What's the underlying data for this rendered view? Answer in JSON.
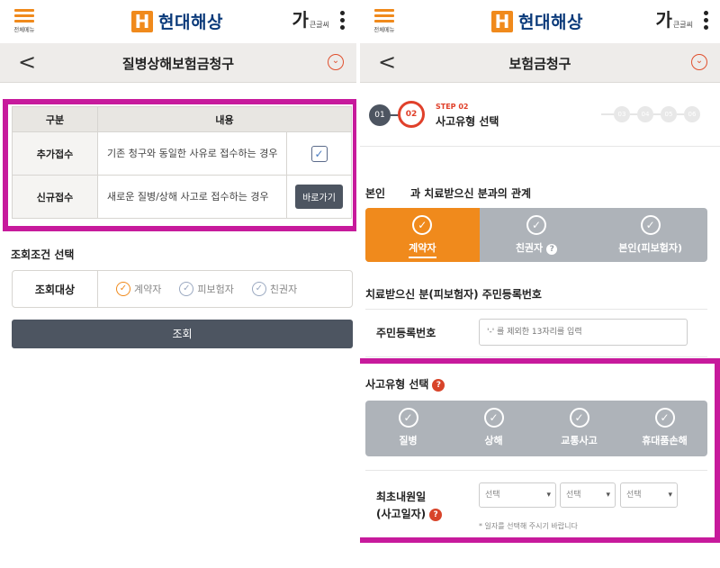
{
  "common": {
    "menu_label": "전체메뉴",
    "logo_mark": "H",
    "logo_text": "현대해상",
    "fontsize_big": "가",
    "fontsize_small": "큰글씨",
    "back_glyph": "<",
    "help_glyph": "⌄",
    "accent_color": "#f08a1c",
    "highlight_color": "#c71a9c"
  },
  "left": {
    "title": "질병상해보험금청구",
    "table": {
      "headers": [
        "구분",
        "내용"
      ],
      "rows": [
        {
          "kind": "추가접수",
          "desc": "기존 청구와 동일한 사유로 접수하는 경우",
          "action": "checkbox"
        },
        {
          "kind": "신규접수",
          "desc": "새로운 질병/상해 사고로 접수하는 경우",
          "action_label": "바로가기"
        }
      ]
    },
    "query_section_title": "조회조건 선택",
    "query_label": "조회대상",
    "options": [
      {
        "label": "계약자",
        "selected": true
      },
      {
        "label": "피보험자",
        "selected": false
      },
      {
        "label": "친권자",
        "selected": false
      }
    ],
    "search_button": "조회"
  },
  "right": {
    "title": "보험금청구",
    "steps": {
      "done": "01",
      "current": "02",
      "kicker": "STEP 02",
      "current_name": "사고유형 선택",
      "remaining": [
        "03",
        "04",
        "05",
        "06"
      ]
    },
    "relation_label_prefix": "본인",
    "relation_label_suffix": "과 치료받으신 분과의 관계",
    "relation_options": [
      {
        "label": "계약자",
        "selected": true
      },
      {
        "label": "친권자",
        "selected": false,
        "help": "?"
      },
      {
        "label": "본인(피보험자)",
        "selected": false
      }
    ],
    "id_section_title": "치료받으신 분(피보험자) 주민등록번호",
    "id_label": "주민등록번호",
    "id_placeholder": "'-' 를 제외한 13자리를 입력",
    "accident_title": "사고유형 선택",
    "accident_types": [
      "질병",
      "상해",
      "교통사고",
      "휴대품손해"
    ],
    "date_label_line1": "최초내원일",
    "date_label_line2": "(사고일자)",
    "selects": [
      "선택",
      "선택",
      "선택"
    ],
    "date_note": "* 일자를 선택해 주시기 바랍니다"
  }
}
